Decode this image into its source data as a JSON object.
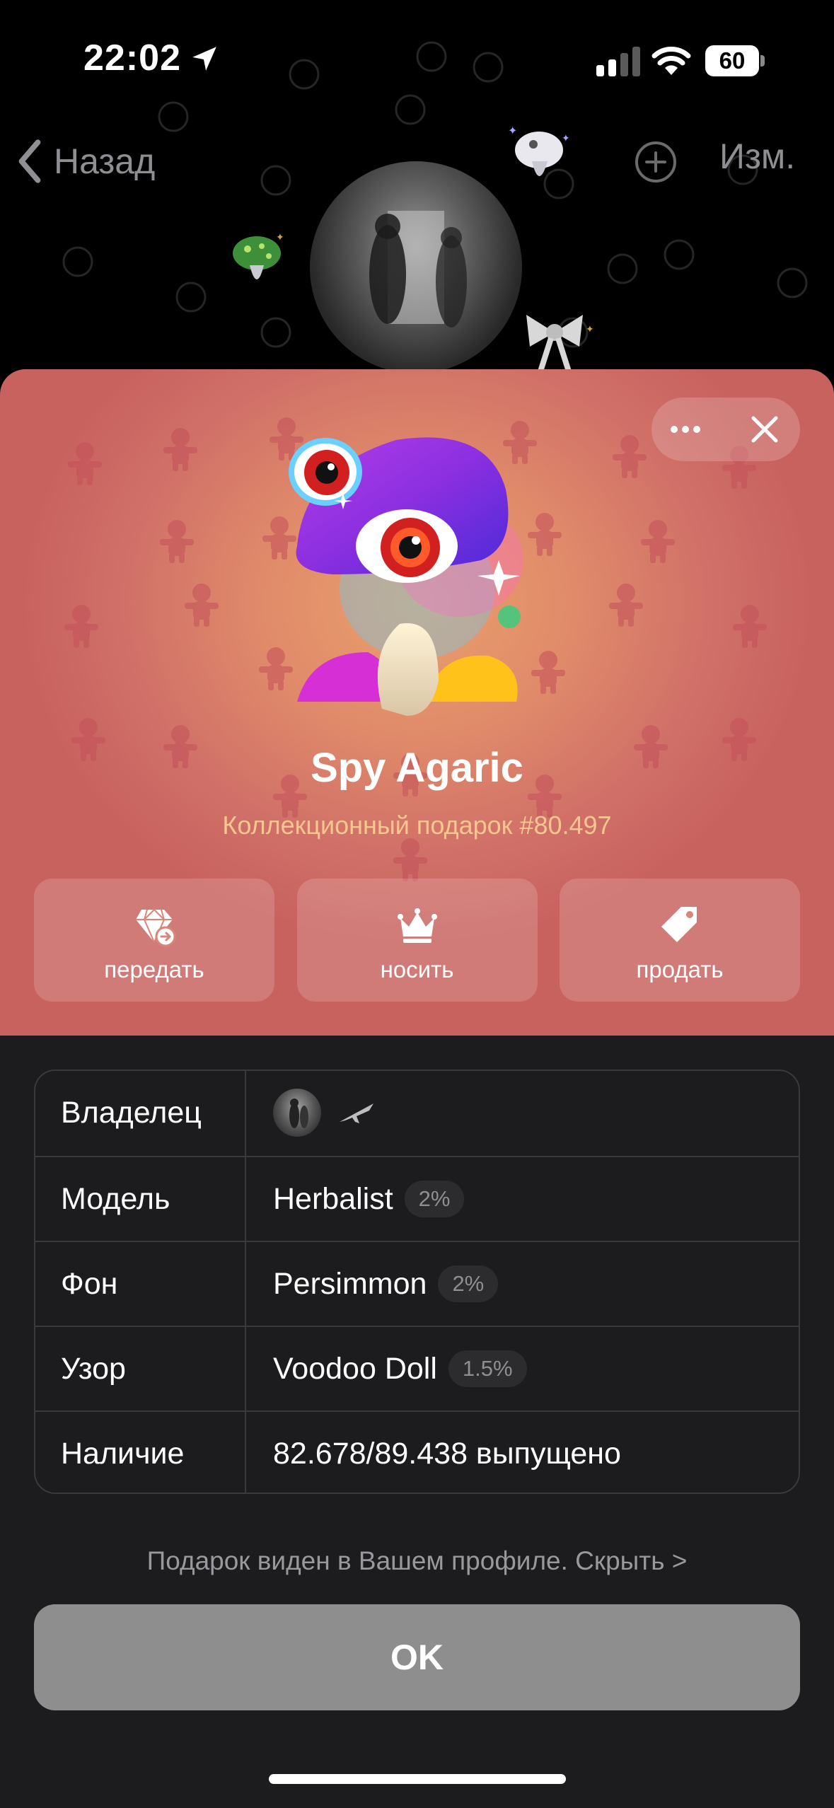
{
  "status_bar": {
    "time": "22:02",
    "battery": "60",
    "icons": [
      "location-arrow-icon",
      "cellular-signal-icon",
      "wifi-icon",
      "battery-icon"
    ]
  },
  "nav": {
    "back_label": "Назад",
    "edit_label": "Изм."
  },
  "gift": {
    "title": "Spy Agaric",
    "subtitle": "Коллекционный подарок #80.497",
    "colors": {
      "background_center": "#e9a06a",
      "background_edge": "#c8625f",
      "subtitle": "#f7c78f"
    }
  },
  "actions": [
    {
      "icon": "gem-transfer-icon",
      "label": "передать"
    },
    {
      "icon": "crown-icon",
      "label": "носить"
    },
    {
      "icon": "price-tag-icon",
      "label": "продать"
    }
  ],
  "info": {
    "owner": {
      "key": "Владелец"
    },
    "model": {
      "key": "Модель",
      "value": "Herbalist",
      "badge": "2%"
    },
    "backdrop": {
      "key": "Фон",
      "value": "Persimmon",
      "badge": "2%"
    },
    "symbol": {
      "key": "Узор",
      "value": "Voodoo Doll",
      "badge": "1.5%"
    },
    "availability": {
      "key": "Наличие",
      "value": "82.678/89.438 выпущено"
    }
  },
  "visibility_text": "Подарок виден в Вашем профиле. Скрыть >",
  "ok_label": "OK"
}
